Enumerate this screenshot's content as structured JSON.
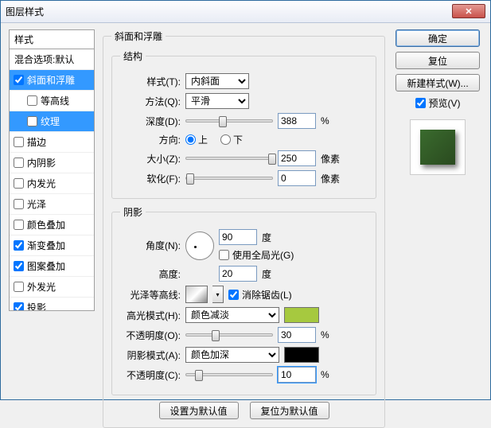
{
  "title": "图层样式",
  "left": {
    "header": "样式",
    "blend": "混合选项:默认",
    "items": [
      "斜面和浮雕",
      "等高线",
      "纹理",
      "描边",
      "内阴影",
      "内发光",
      "光泽",
      "颜色叠加",
      "渐变叠加",
      "图案叠加",
      "外发光",
      "投影"
    ]
  },
  "mid": {
    "bevel_title": "斜面和浮雕",
    "structure": "结构",
    "style_l": "样式(T):",
    "style_v": "内斜面",
    "tech_l": "方法(Q):",
    "tech_v": "平滑",
    "depth_l": "深度(D):",
    "depth_v": "388",
    "pct": "%",
    "dir_l": "方向:",
    "dir_up": "上",
    "dir_down": "下",
    "size_l": "大小(Z):",
    "size_v": "250",
    "px": "像素",
    "soft_l": "软化(F):",
    "soft_v": "0",
    "shading": "阴影",
    "angle_l": "角度(N):",
    "angle_v": "90",
    "deg": "度",
    "global": "使用全局光(G)",
    "alt_l": "高度:",
    "alt_v": "20",
    "gloss_l": "光泽等高线:",
    "antialias": "消除锯齿(L)",
    "hl_mode_l": "高光模式(H):",
    "hl_mode_v": "颜色减淡",
    "opac_l_o": "不透明度(O):",
    "hl_op_v": "30",
    "sh_mode_l": "阴影模式(A):",
    "sh_mode_v": "颜色加深",
    "opac_l_c": "不透明度(C):",
    "sh_op_v": "10",
    "make_default": "设置为默认值",
    "reset_default": "复位为默认值"
  },
  "right": {
    "ok": "确定",
    "cancel": "复位",
    "new_style": "新建样式(W)...",
    "preview": "预览(V)"
  }
}
